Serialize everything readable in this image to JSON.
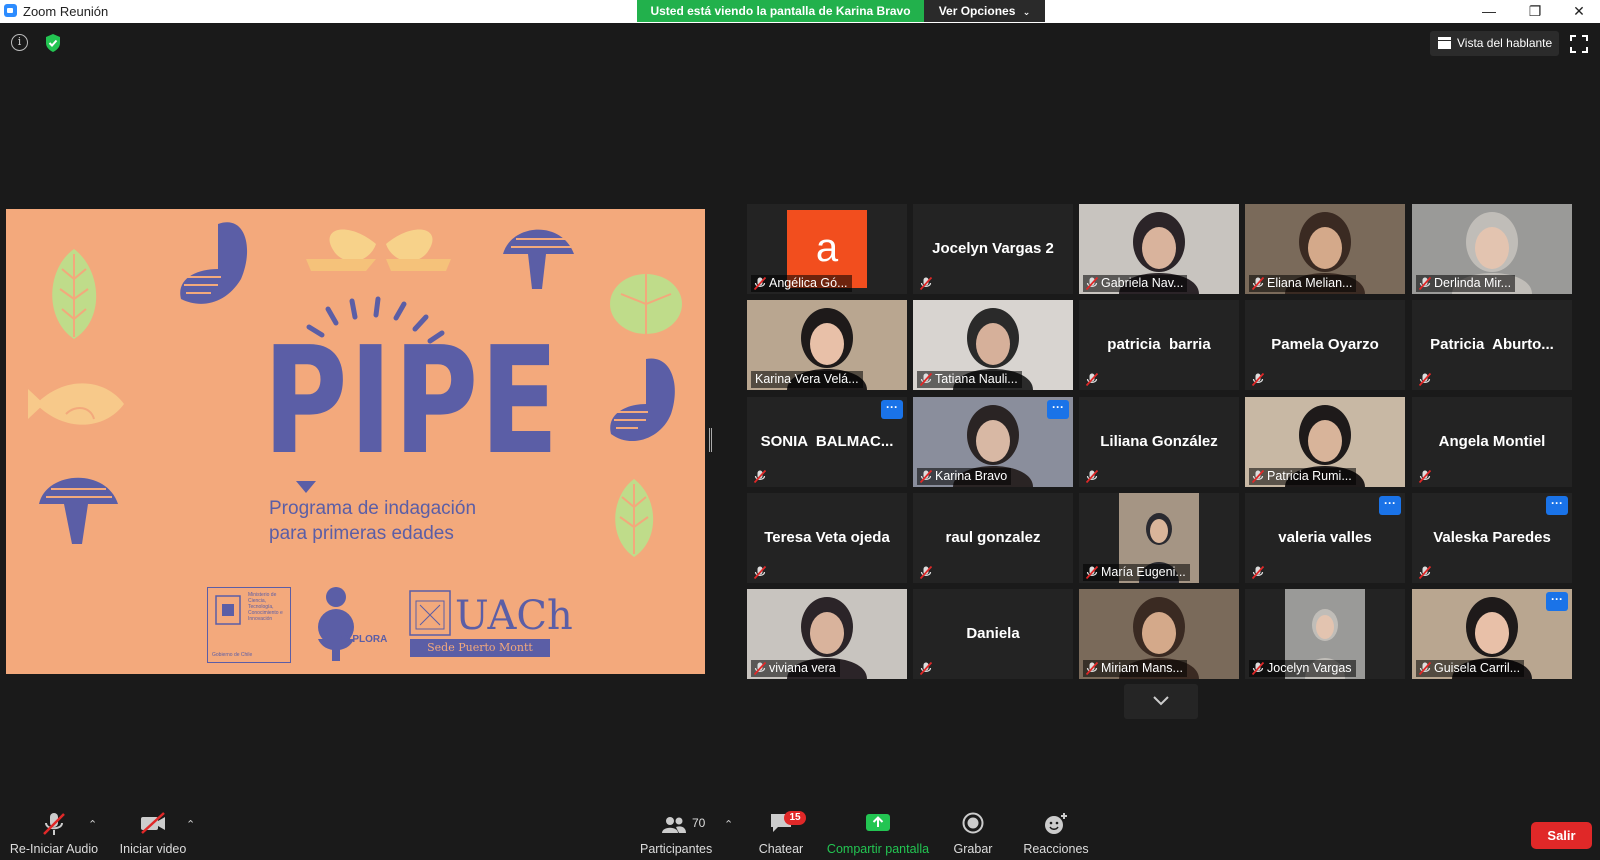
{
  "window": {
    "title": "Zoom Reunión",
    "share_banner": "Usted está viendo la pantalla de Karina Bravo",
    "view_options": "Ver Opciones"
  },
  "top": {
    "speaker_view": "Vista del hablante"
  },
  "slide": {
    "title": "PIPE",
    "subtitle_line1": "Programa de indagación",
    "subtitle_line2": "para primeras edades",
    "logo_ministry": "Ministerio de Ciencia, Tecnología, Conocimiento e Innovación",
    "logo_ministry_sub": "Gobierno de Chile",
    "logo_explora": "EXPLORA",
    "logo_uach": "UACh",
    "logo_uach_sub": "Sede Puerto Montt"
  },
  "participants": [
    {
      "name": "Angélica Gó...",
      "type": "avatar",
      "avatar_letter": "a",
      "muted": true
    },
    {
      "name": "Jocelyn Vargas 2",
      "type": "name",
      "muted": true
    },
    {
      "name": "Gabriela Nav...",
      "type": "video",
      "muted": true
    },
    {
      "name": "Eliana Melian...",
      "type": "video",
      "muted": true
    },
    {
      "name": "Derlinda Mir...",
      "type": "video",
      "muted": true
    },
    {
      "name": "Karina Vera Velá...",
      "type": "video",
      "muted": false,
      "active_speaker": true
    },
    {
      "name": "Tatiana Nauli...",
      "type": "video",
      "muted": true
    },
    {
      "name": "patricia  barria",
      "type": "name",
      "muted": true
    },
    {
      "name": "Pamela Oyarzo",
      "type": "name",
      "muted": true
    },
    {
      "name": "Patricia  Aburto...",
      "type": "name",
      "muted": true
    },
    {
      "name": "SONIA  BALMAC...",
      "type": "name",
      "muted": true,
      "more": true
    },
    {
      "name": "Karina Bravo",
      "type": "video",
      "muted": true,
      "more": true
    },
    {
      "name": "Liliana González",
      "type": "name",
      "muted": true
    },
    {
      "name": "Patricia Rumi...",
      "type": "video",
      "muted": true
    },
    {
      "name": "Angela Montiel",
      "type": "name",
      "muted": true
    },
    {
      "name": "Teresa Veta ojeda",
      "type": "name",
      "muted": true
    },
    {
      "name": "raul gonzalez",
      "type": "name",
      "muted": true
    },
    {
      "name": "María Eugeni...",
      "type": "photo",
      "muted": true
    },
    {
      "name": "valeria valles",
      "type": "name",
      "muted": true,
      "more": true
    },
    {
      "name": "Valeska Paredes",
      "type": "name",
      "muted": true,
      "more": true
    },
    {
      "name": "viviana vera",
      "type": "video",
      "muted": true
    },
    {
      "name": "Daniela",
      "type": "name",
      "muted": true
    },
    {
      "name": "Miriam Mans...",
      "type": "video",
      "muted": true
    },
    {
      "name": "Jocelyn Vargas",
      "type": "photo",
      "muted": true
    },
    {
      "name": "Guisela Carril...",
      "type": "video",
      "muted": true,
      "more": true
    }
  ],
  "toolbar": {
    "audio": "Re-Iniciar Audio",
    "video": "Iniciar video",
    "participants": "Participantes",
    "participants_count": "70",
    "chat": "Chatear",
    "chat_badge": "15",
    "share": "Compartir pantalla",
    "record": "Grabar",
    "reactions": "Reacciones",
    "leave": "Salir"
  },
  "colors": {
    "share_green": "#22b14c",
    "leave_red": "#e02828",
    "slide_bg": "#f3a97c",
    "slide_ink": "#5b5ea6",
    "active_border": "#c4d838"
  }
}
